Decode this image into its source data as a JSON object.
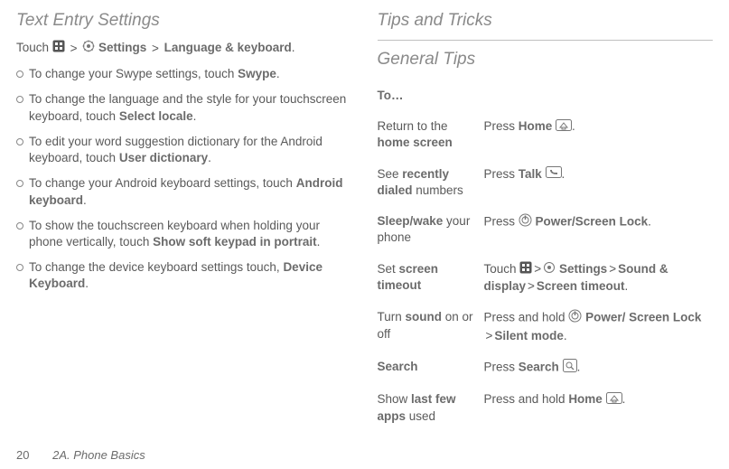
{
  "left": {
    "title": "Text Entry Settings",
    "intro_pre": "Touch",
    "intro_settings": "Settings",
    "intro_lk": "Language & keyboard",
    "intro_end": ".",
    "bullets": [
      {
        "pre": "To change your Swype settings, touch ",
        "b1": "Swype",
        "post": "."
      },
      {
        "pre": "To change the language and the style for your touchscreen keyboard, touch ",
        "b1": "Select locale",
        "post": "."
      },
      {
        "pre": "To edit your word suggestion dictionary for the Android keyboard, touch ",
        "b1": "User dictionary",
        "post": "."
      },
      {
        "pre": "To change your Android keyboard settings, touch ",
        "b1": "Android keyboard",
        "post": "."
      },
      {
        "pre": "To show the touchscreen keyboard when holding your phone vertically, touch ",
        "b1": "Show soft keypad in portrait",
        "post": "."
      },
      {
        "pre": "To change the device keyboard settings touch, ",
        "b1": "Device Keyboard",
        "post": "."
      }
    ]
  },
  "right": {
    "title": "Tips and Tricks",
    "subtitle": "General Tips",
    "to_label": "To…",
    "rows": [
      {
        "l_pre": "Return to the ",
        "l_b": "home screen",
        "l_post": "",
        "r_pre": "Press ",
        "r_b": "Home",
        "r_post": ".",
        "r_icon": "home"
      },
      {
        "l_pre": "See ",
        "l_b": "recently dialed",
        "l_post": " numbers",
        "r_pre": "Press ",
        "r_b": "Talk",
        "r_post": ".",
        "r_icon": "talk"
      },
      {
        "l_pre": "",
        "l_b": "Sleep/wake",
        "l_post": " your phone",
        "r_pre": "Press ",
        "r_b": "Power/Screen Lock",
        "r_post": ".",
        "r_icon": "power-before"
      },
      {
        "l_pre": "Set ",
        "l_b": "screen timeout",
        "l_post": "",
        "r_special": "screentimeout"
      },
      {
        "l_pre": "Turn ",
        "l_b": "sound",
        "l_post": " on or off",
        "r_special": "sound"
      },
      {
        "l_pre": "",
        "l_b": "Search",
        "l_post": "",
        "r_pre": "Press ",
        "r_b": "Search",
        "r_post": ".",
        "r_icon": "search-after"
      },
      {
        "l_pre": "Show ",
        "l_b": "last few apps",
        "l_post": " used",
        "r_pre": "Press and hold ",
        "r_b": "Home",
        "r_post": ".",
        "r_icon": "home"
      }
    ],
    "screentimeout": {
      "touch": "Touch",
      "settings": "Settings",
      "sd": "Sound & display",
      "st": "Screen timeout",
      "end": "."
    },
    "sound": {
      "pre": "Press and hold ",
      "pl": "Power/ Screen Lock",
      "sm": "Silent mode",
      "end": "."
    }
  },
  "footer": {
    "page": "20",
    "section": "2A. Phone Basics"
  }
}
